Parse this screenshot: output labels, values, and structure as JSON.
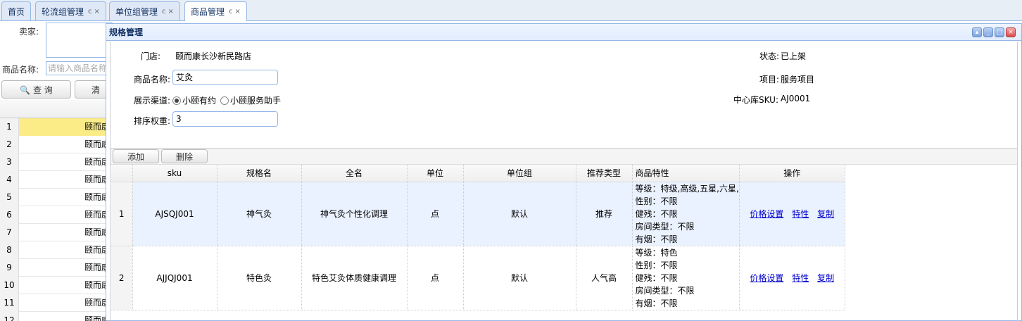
{
  "tabs": [
    {
      "label": "首页",
      "closable": false
    },
    {
      "label": "轮流组管理",
      "closable": true
    },
    {
      "label": "单位组管理",
      "closable": true
    },
    {
      "label": "商品管理",
      "closable": true,
      "active": true
    }
  ],
  "tab_icons": {
    "refresh": "c",
    "close": "×"
  },
  "background": {
    "seller_label": "卖家:",
    "product_name_label": "商品名称:",
    "product_name_placeholder": "请输入商品名称",
    "query_button": "🔍 查 询",
    "clear_button": "清",
    "rows": [
      {
        "num": "1",
        "text": "颐而康"
      },
      {
        "num": "2",
        "text": "颐而康"
      },
      {
        "num": "3",
        "text": "颐而康"
      },
      {
        "num": "4",
        "text": "颐而康"
      },
      {
        "num": "5",
        "text": "颐而康"
      },
      {
        "num": "6",
        "text": "颐而康"
      },
      {
        "num": "7",
        "text": "颐而康"
      },
      {
        "num": "8",
        "text": "颐而康"
      },
      {
        "num": "9",
        "text": "颐而康"
      },
      {
        "num": "10",
        "text": "颐而康"
      },
      {
        "num": "11",
        "text": "颐而康"
      },
      {
        "num": "12",
        "text": "颐而康"
      }
    ]
  },
  "dialog": {
    "title": "规格管理",
    "form": {
      "store_label": "门店:",
      "store_value": "颐而康长沙新民路店",
      "status_label": "状态:",
      "status_value": "已上架",
      "product_name_label": "商品名称:",
      "product_name_value": "艾灸",
      "project_label": "项目:",
      "project_value": "服务项目",
      "channel_label": "展示渠道:",
      "channel_option1": "小颐有约",
      "channel_option2": "小颐服务助手",
      "sku_label": "中心库SKU:",
      "sku_value": "AJ0001",
      "sort_label": "排序权重:",
      "sort_value": "3"
    },
    "toolbar": {
      "add": "添加",
      "delete": "删除"
    },
    "columns": [
      "sku",
      "规格名",
      "全名",
      "单位",
      "单位组",
      "推荐类型",
      "商品特性",
      "操作"
    ],
    "rows": [
      {
        "num": "1",
        "sku": "AJSQJ001",
        "spec": "神气灸",
        "fullname": "神气灸个性化调理",
        "unit": "点",
        "unit_group": "默认",
        "rec_type": "推荐",
        "features": [
          "等级：特级,高级,五星,六星,",
          "性别：不限",
          "健残：不限",
          "房间类型：不限",
          "有烟：不限"
        ]
      },
      {
        "num": "2",
        "sku": "AJJQJ001",
        "spec": "特色灸",
        "fullname": "特色艾灸体质健康调理",
        "unit": "点",
        "unit_group": "默认",
        "rec_type": "人气高",
        "features": [
          "等级：特色",
          "性别：不限",
          "健残：不限",
          "房间类型：不限",
          "有烟：不限"
        ]
      }
    ],
    "ops": {
      "price": "价格设置",
      "feature": "特性",
      "copy": "复制"
    }
  }
}
